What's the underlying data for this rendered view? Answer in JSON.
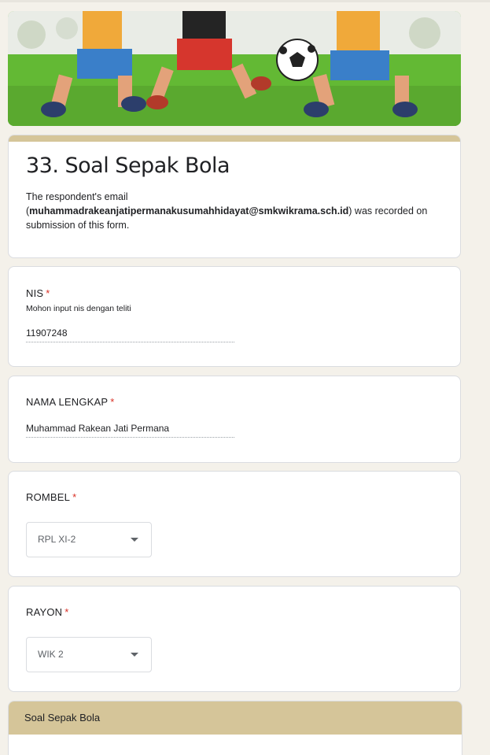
{
  "form": {
    "title": "33. Soal Sepak Bola",
    "email_note_prefix": "The respondent's email (",
    "email": "muhammadrakeanjatipermanakusumahhidayat@smkwikrama.sch.id",
    "email_note_suffix": ") was recorded on submission of this form."
  },
  "questions": {
    "nis": {
      "title": "NIS",
      "required": "*",
      "description": "Mohon input nis dengan teliti",
      "value": "11907248"
    },
    "nama": {
      "title": "NAMA LENGKAP",
      "required": "*",
      "value": "Muhammad Rakean Jati Permana"
    },
    "rombel": {
      "title": "ROMBEL",
      "required": "*",
      "selected": "RPL XI-2"
    },
    "rayon": {
      "title": "RAYON",
      "required": "*",
      "selected": "WIK 2"
    }
  },
  "section": {
    "title": "Soal Sepak Bola"
  },
  "colors": {
    "theme": "#d5c599",
    "background": "#f4f1ea",
    "required": "#d93025"
  }
}
